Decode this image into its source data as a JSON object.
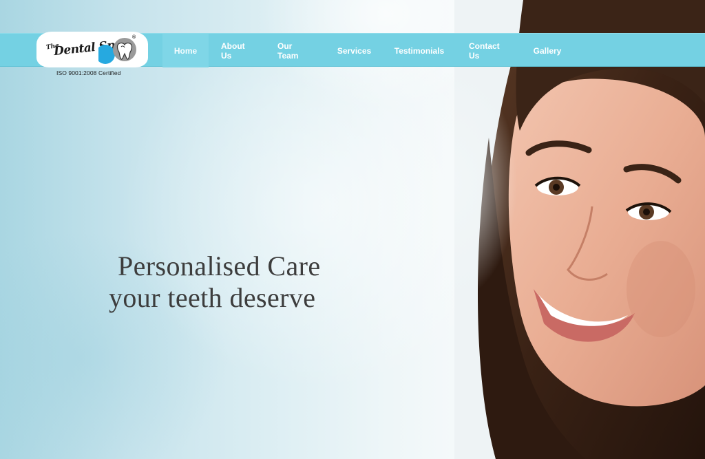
{
  "brand": {
    "logo_the": "The",
    "logo_name": "Dental Spa",
    "logo_registered": "®",
    "certification": "ISO 9001:2008 Certified"
  },
  "nav": {
    "items": [
      {
        "label": "Home",
        "active": true
      },
      {
        "label": "About Us",
        "active": false
      },
      {
        "label": "Our Team",
        "active": false
      },
      {
        "label": "Services",
        "active": false
      },
      {
        "label": "Testimonials",
        "active": false
      },
      {
        "label": "Contact Us",
        "active": false
      },
      {
        "label": "Gallery",
        "active": false
      }
    ]
  },
  "hero": {
    "headline_line1": "Personalised Care",
    "headline_line2": "your teeth deserve"
  },
  "colors": {
    "nav_bar": "#74d1e3",
    "nav_active": "#7fd6e7",
    "nav_text": "#ffffff",
    "headline_text": "#3d3d3d",
    "logo_circle_blue": "#26a9e0",
    "logo_circle_gray": "#9a9a9a"
  },
  "icons": {
    "logo_mark": "tooth-icon"
  }
}
